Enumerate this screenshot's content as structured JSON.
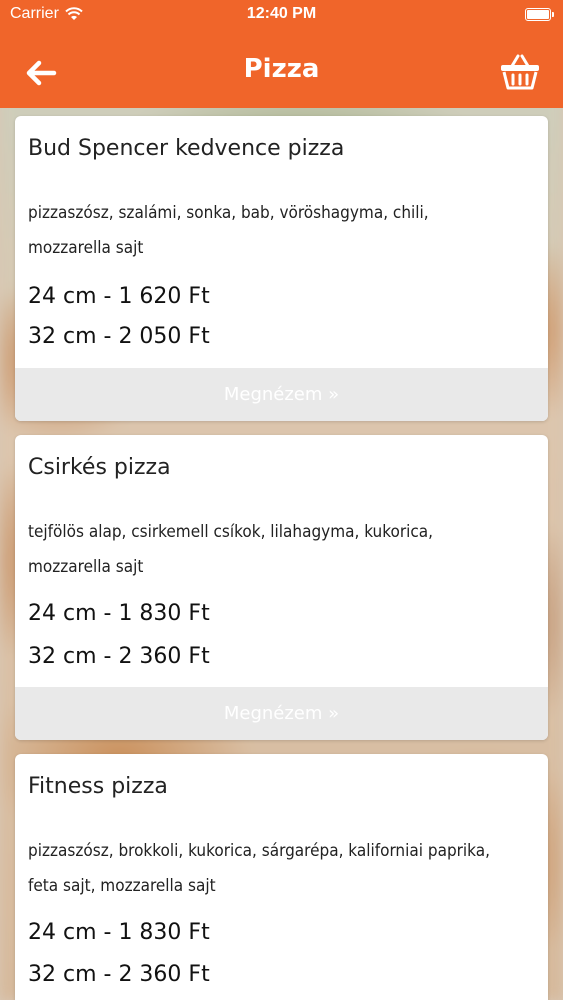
{
  "status_bar": {
    "carrier": "Carrier",
    "time": "12:40 PM",
    "icons": [
      "wifi-icon",
      "battery-icon"
    ]
  },
  "nav": {
    "title": "Pizza",
    "back_icon": "arrow-left-icon",
    "cart_icon": "shopping-basket-icon"
  },
  "colors": {
    "accent": "#f0652a",
    "card_background": "#ffffff",
    "button_background": "#e9e9e9"
  },
  "pizzas": [
    {
      "name": "Bud Spencer kedvence pizza",
      "ingredients_line1": "pizzaszósz, szalámi, sonka, bab, vöröshagyma, chili,",
      "ingredients_line2": "mozzarella  sajt",
      "price_small": "24 cm - 1 620 Ft",
      "price_large": "32 cm - 2 050 Ft",
      "button": "Megnézem »"
    },
    {
      "name": "Csirkés pizza",
      "ingredients_line1": "tejfölös alap, csirkemell csíkok, lilahagyma, kukorica,",
      "ingredients_line2": "mozzarella  sajt",
      "price_small": "24 cm - 1 830 Ft",
      "price_large": "32 cm - 2 360 Ft",
      "button": "Megnézem »"
    },
    {
      "name": "Fitness pizza",
      "ingredients_line1": "pizzaszósz, brokkoli, kukorica, sárgarépa, kaliforniai paprika,",
      "ingredients_line2": "feta sajt, mozzarella  sajt",
      "price_small": "24 cm - 1 830 Ft",
      "price_large": "32 cm - 2 360 Ft"
    }
  ]
}
